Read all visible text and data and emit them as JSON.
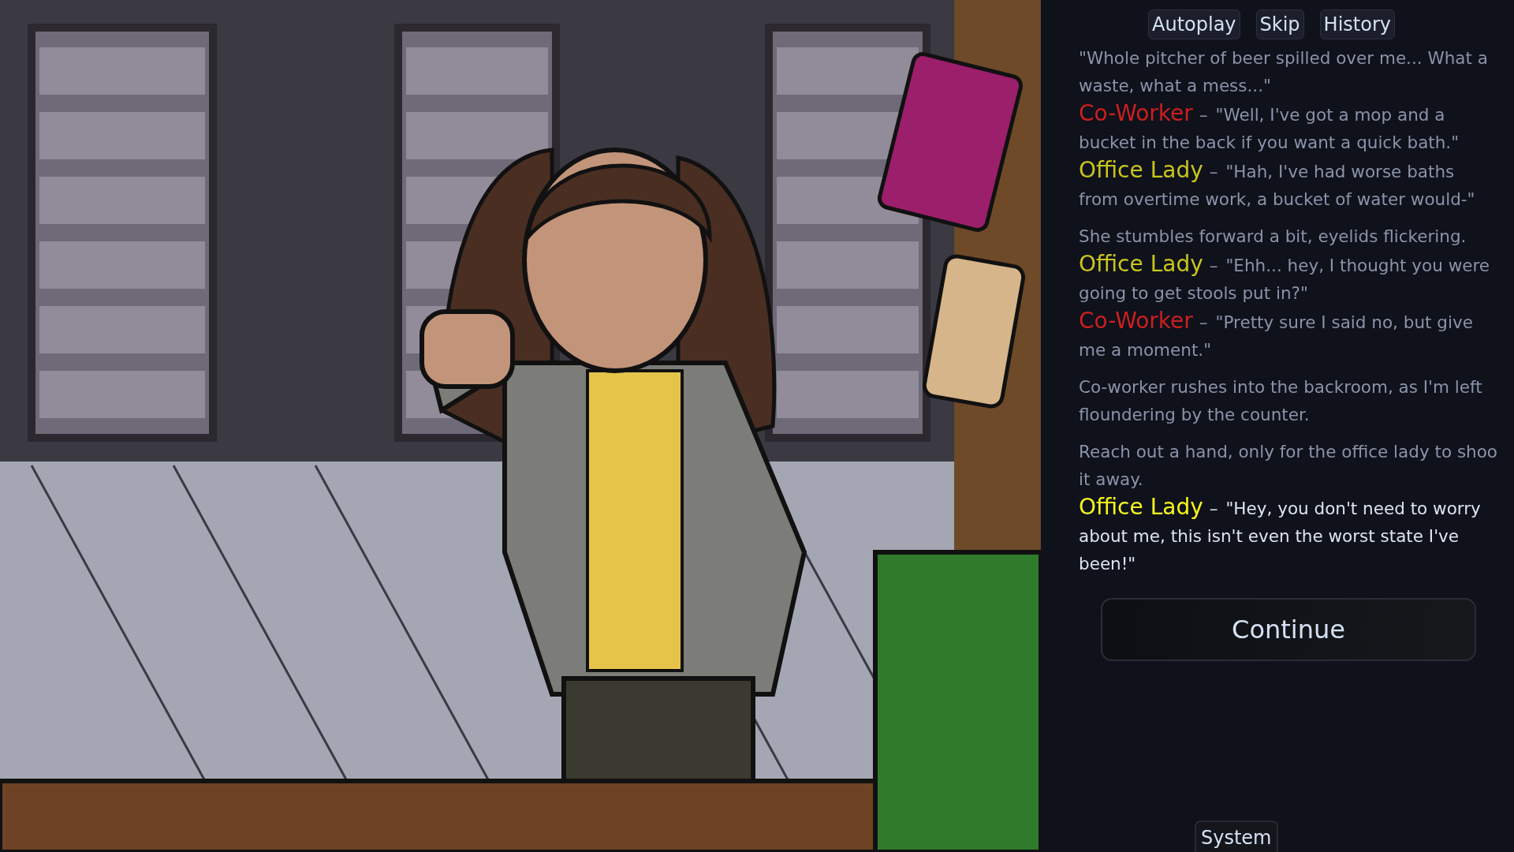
{
  "quick_menu": [
    {
      "label": "Autoplay"
    },
    {
      "label": "Skip"
    },
    {
      "label": "History"
    }
  ],
  "log": [
    {
      "kind": "narration",
      "text": "\"Whole pitcher of beer spilled over me... What a waste, what a mess...\"",
      "current": false
    },
    {
      "kind": "dialogue",
      "speaker": "Co-Worker",
      "separator": "–",
      "color": "#cc1f1f",
      "text": "\"Well, I've got a mop and a bucket in the back if you want a quick bath.\"",
      "current": false
    },
    {
      "kind": "dialogue",
      "speaker": "Office Lady",
      "separator": "–",
      "color": "#c9c51c",
      "text": "\"Hah, I've had worse baths from overtime work, a bucket of water would-\"",
      "current": false
    },
    {
      "kind": "narration",
      "text": "She stumbles forward a bit, eyelids flickering.",
      "current": false
    },
    {
      "kind": "dialogue",
      "speaker": "Office Lady",
      "separator": "–",
      "color": "#c9c51c",
      "text": "\"Ehh... hey, I thought you were going to get stools put in?\"",
      "current": false
    },
    {
      "kind": "dialogue",
      "speaker": "Co-Worker",
      "separator": "–",
      "color": "#cc1f1f",
      "text": "\"Pretty sure I said no, but give me a moment.\"",
      "current": false
    },
    {
      "kind": "narration",
      "text": "Co-worker rushes into the backroom, as I'm left floundering by the counter.",
      "current": false
    },
    {
      "kind": "narration",
      "text": "Reach out a hand, only for the office lady to shoo it away.",
      "current": false
    },
    {
      "kind": "dialogue",
      "speaker": "Office Lady",
      "separator": "–",
      "color": "#f5f51a",
      "text": "\"Hey, you don't need to worry about me, this isn't even the worst state I've been!\"",
      "current": true
    }
  ],
  "continue_button": {
    "label": "Continue"
  },
  "system_button": {
    "label": "System"
  }
}
